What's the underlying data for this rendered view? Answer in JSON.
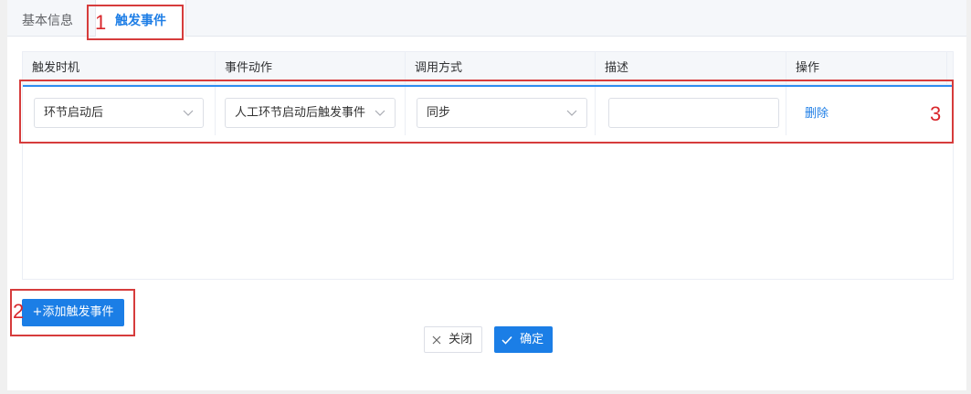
{
  "tabs": {
    "basic_info": "基本信息",
    "trigger_events": "触发事件"
  },
  "table": {
    "columns": [
      "触发时机",
      "事件动作",
      "调用方式",
      "描述",
      "操作"
    ],
    "rows": [
      {
        "trigger_time": "环节启动后",
        "event_action": "人工环节启动后触发事件",
        "call_mode": "同步",
        "description": "",
        "delete_label": "删除"
      }
    ]
  },
  "buttons": {
    "add_event": "+添加触发事件",
    "close": "关闭",
    "confirm": "确定"
  },
  "annotations": {
    "mark1": "1",
    "mark2": "2",
    "mark3": "3"
  },
  "colors": {
    "primary": "#1b7ee6",
    "annotation_red": "#d63c3c",
    "header_bg": "#f5f7fa"
  }
}
